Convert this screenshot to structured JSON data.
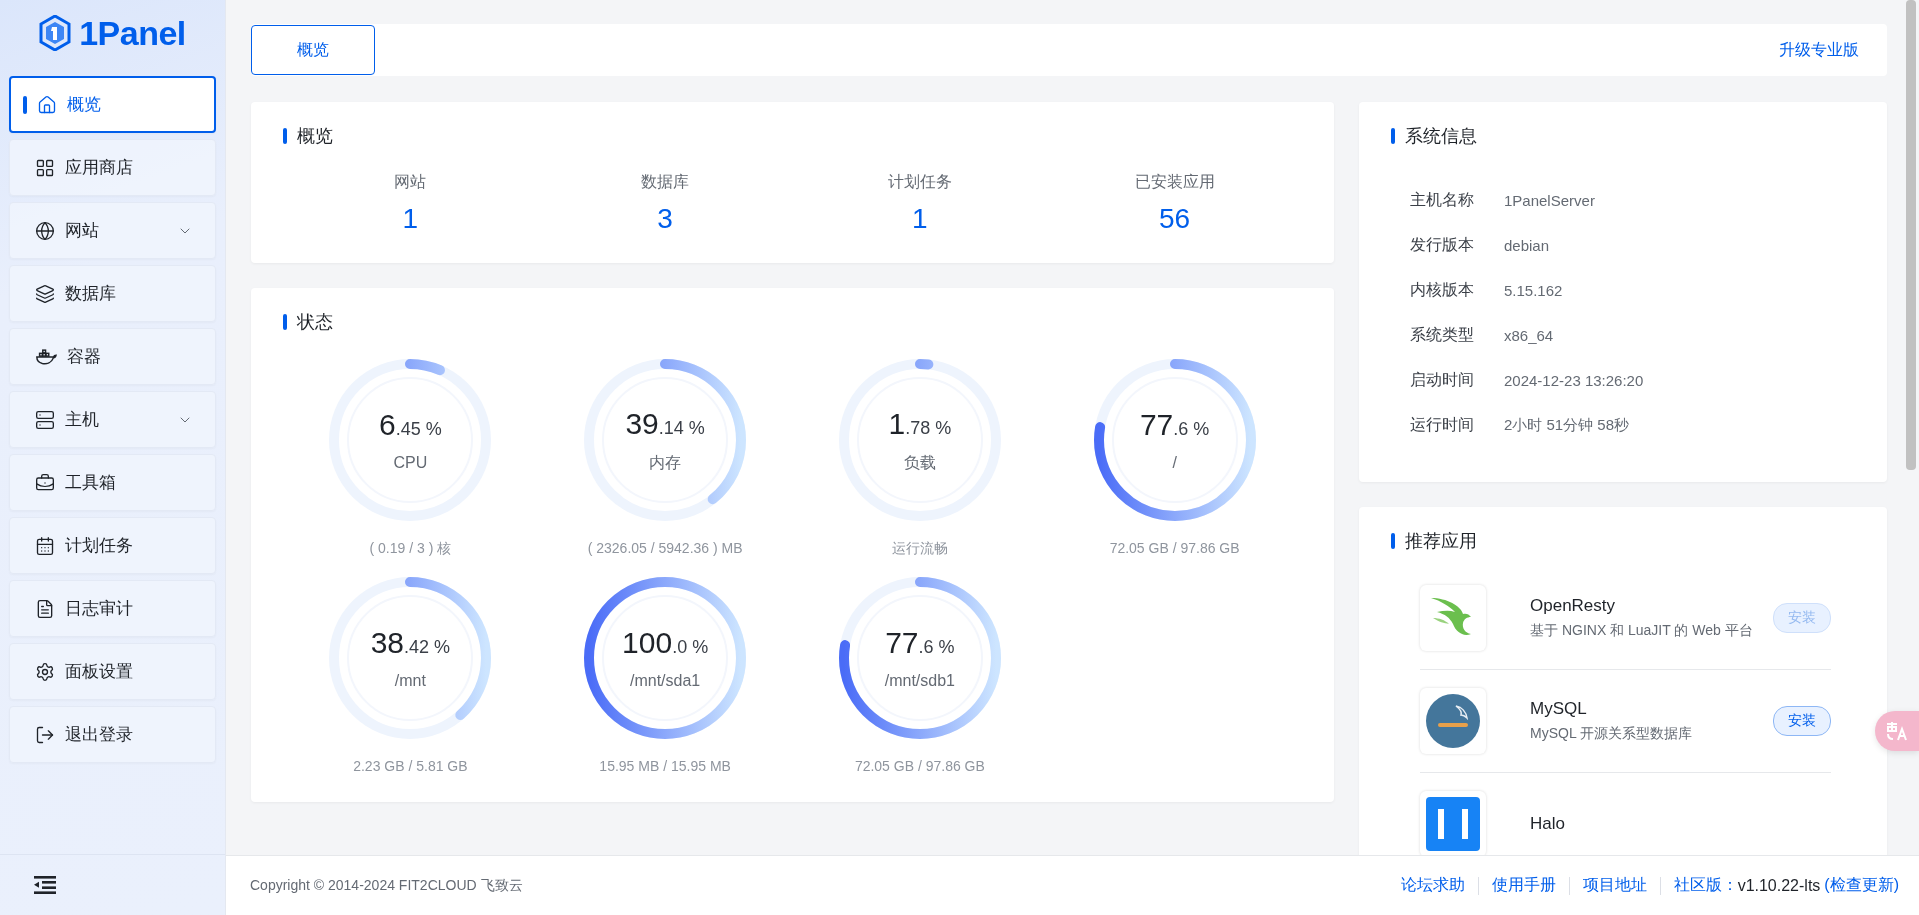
{
  "logo": {
    "name": "1Panel"
  },
  "sidebar": {
    "items": [
      {
        "label": "概览",
        "kind": "link",
        "selected": true
      },
      {
        "label": "应用商店",
        "kind": "link",
        "selected": false
      },
      {
        "label": "网站",
        "kind": "group",
        "selected": false
      },
      {
        "label": "数据库",
        "kind": "link",
        "selected": false
      },
      {
        "label": "容器",
        "kind": "link",
        "selected": false
      },
      {
        "label": "主机",
        "kind": "group",
        "selected": false
      },
      {
        "label": "工具箱",
        "kind": "link",
        "selected": false
      },
      {
        "label": "计划任务",
        "kind": "link",
        "selected": false
      },
      {
        "label": "日志审计",
        "kind": "link",
        "selected": false
      },
      {
        "label": "面板设置",
        "kind": "link",
        "selected": false
      },
      {
        "label": "退出登录",
        "kind": "link",
        "selected": false
      }
    ]
  },
  "top_bar": {
    "tabs": [
      {
        "label": "概览",
        "selected": true
      }
    ],
    "upgrade_link": "升级专业版"
  },
  "overview": {
    "title": "概览",
    "stats": [
      {
        "label": "网站",
        "value": "1"
      },
      {
        "label": "数据库",
        "value": "3"
      },
      {
        "label": "计划任务",
        "value": "1"
      },
      {
        "label": "已安装应用",
        "value": "56"
      }
    ]
  },
  "status": {
    "title": "状态",
    "gauges": [
      {
        "whole": "6",
        "fraction": ".45 %",
        "label": "CPU",
        "detail": "( 0.19 / 3 ) 核",
        "level": 0.0645
      },
      {
        "whole": "39",
        "fraction": ".14 %",
        "label": "内存",
        "detail": "( 2326.05 / 5942.36 ) MB",
        "level": 0.3914
      },
      {
        "whole": "1",
        "fraction": ".78 %",
        "label": "负载",
        "detail": "运行流畅",
        "level": 0.0178
      },
      {
        "whole": "77",
        "fraction": ".6 %",
        "label": "/",
        "detail": "72.05 GB / 97.86 GB",
        "level": 0.776
      },
      {
        "whole": "38",
        "fraction": ".42 %",
        "label": "/mnt",
        "detail": "2.23 GB / 5.81 GB",
        "level": 0.3842
      },
      {
        "whole": "100",
        "fraction": ".0 %",
        "label": "/mnt/sda1",
        "detail": "15.95 MB / 15.95 MB",
        "level": 1.0
      },
      {
        "whole": "77",
        "fraction": ".6 %",
        "label": "/mnt/sdb1",
        "detail": "72.05 GB / 97.86 GB",
        "level": 0.776
      }
    ]
  },
  "system_info": {
    "title": "系统信息",
    "rows": [
      {
        "label": "主机名称",
        "value": "1PanelServer"
      },
      {
        "label": "发行版本",
        "value": "debian"
      },
      {
        "label": "内核版本",
        "value": "5.15.162"
      },
      {
        "label": "系统类型",
        "value": "x86_64"
      },
      {
        "label": "启动时间",
        "value": "2024-12-23 13:26:20"
      },
      {
        "label": "运行时间",
        "value": "2小时 51分钟 58秒"
      }
    ]
  },
  "recommended_apps": {
    "title": "推荐应用",
    "apps": [
      {
        "kind": "bird",
        "name": "OpenResty",
        "description": "基于 NGINX 和 LuaJIT 的 Web 平台",
        "button": "安装",
        "disabled": true
      },
      {
        "kind": "dolphin",
        "name": "MySQL",
        "description": "MySQL 开源关系型数据库",
        "button": "安装",
        "disabled": false
      },
      {
        "kind": "tile",
        "name": "Halo"
      }
    ]
  },
  "footer": {
    "copyright": "Copyright © 2014-2024 FIT2CLOUD 飞致云",
    "links": [
      "论坛求助",
      "使用手册",
      "项目地址"
    ],
    "edition_label": "社区版：",
    "version": "v1.10.22-lts",
    "check_update": "(检查更新)"
  }
}
